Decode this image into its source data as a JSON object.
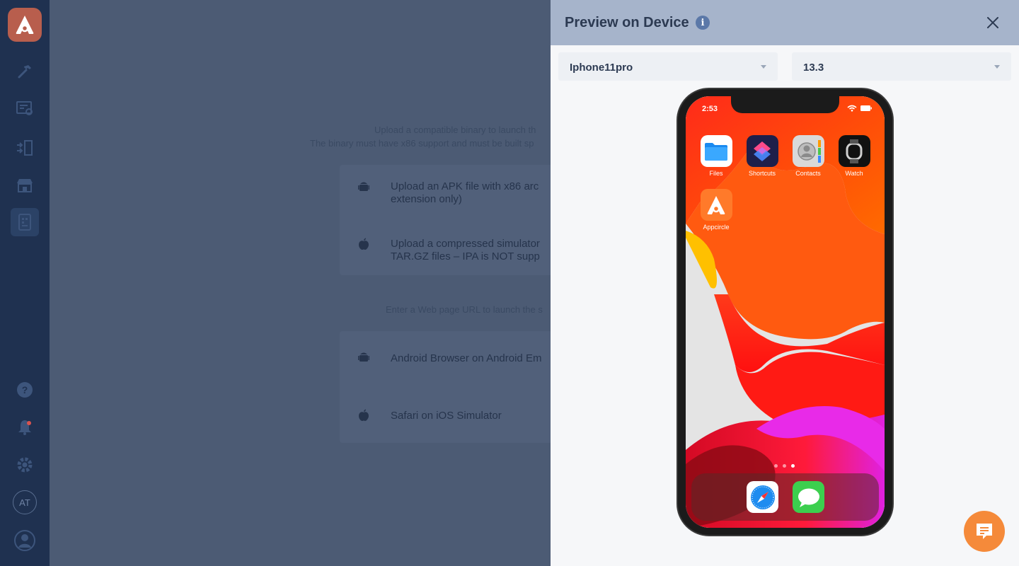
{
  "sidebar": {
    "avatar_initials": "AT",
    "icons": [
      "appcircle-logo-icon",
      "hammer-icon",
      "certificate-icon",
      "distribution-icon",
      "store-icon",
      "device-preview-icon",
      "help-icon",
      "bell-icon",
      "gear-icon",
      "user-icon"
    ]
  },
  "background": {
    "intro_line1": "Upload a compatible binary to launch th",
    "intro_line2": "The binary must have x86 support and must be built sp",
    "upload_apk_line1": "Upload an APK file with x86 arc",
    "upload_apk_line2": "extension only)",
    "upload_sim_line1": "Upload a compressed simulator",
    "upload_sim_line2": "TAR.GZ files – IPA is NOT supp",
    "url_intro": "Enter a Web page URL to launch the s",
    "android_browser": "Android Browser on Android Em",
    "safari": "Safari on iOS Simulator"
  },
  "panel": {
    "title": "Preview on Device",
    "device_select": "Iphone11pro",
    "version_select": "13.3"
  },
  "phone": {
    "time": "2:53",
    "apps": [
      {
        "label": "Files"
      },
      {
        "label": "Shortcuts"
      },
      {
        "label": "Contacts"
      },
      {
        "label": "Watch"
      },
      {
        "label": "Appcircle"
      }
    ],
    "dock_apps": [
      "Safari",
      "Messages"
    ],
    "page_dots": 3,
    "active_page": 3
  },
  "colors": {
    "accent": "#f58a3a",
    "rail": "#1f3150",
    "panel_header": "#a6b4cb"
  }
}
